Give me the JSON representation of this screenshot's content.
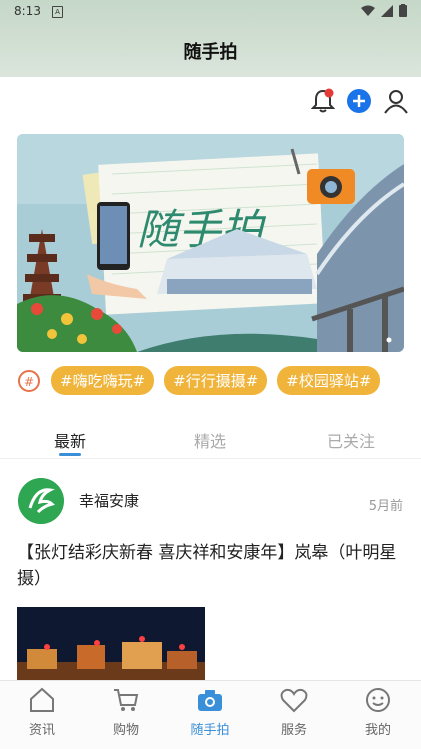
{
  "status_bar": {
    "time": "8:13",
    "sim_label": "A"
  },
  "header": {
    "title": "随手拍"
  },
  "toolbar": {
    "icons": [
      "bell-icon",
      "add-circle-icon",
      "user-icon"
    ],
    "accent": "#1a73e8",
    "badge_color": "#e53935"
  },
  "banner": {
    "calligraphy": "随手拍"
  },
  "topic_tags": [
    "#嗨吃嗨玩#",
    "#行行摄摄#",
    "#校园驿站#"
  ],
  "tabs": [
    {
      "label": "最新",
      "active": true
    },
    {
      "label": "精选",
      "active": false
    },
    {
      "label": "已关注",
      "active": false
    }
  ],
  "post": {
    "author": "幸福安康",
    "time": "5月前",
    "text": "【张灯结彩庆新春  喜庆祥和安康年】岚皋（叶明星  摄）"
  },
  "bottom_nav": [
    {
      "label": "资讯",
      "icon": "home-icon",
      "active": false
    },
    {
      "label": "购物",
      "icon": "cart-icon",
      "active": false
    },
    {
      "label": "随手拍",
      "icon": "camera-icon",
      "active": true
    },
    {
      "label": "服务",
      "icon": "heart-icon",
      "active": false
    },
    {
      "label": "我的",
      "icon": "smiley-icon",
      "active": false
    }
  ],
  "colors": {
    "accent": "#3a8fd9",
    "tag_bg": "#f0b43a"
  }
}
